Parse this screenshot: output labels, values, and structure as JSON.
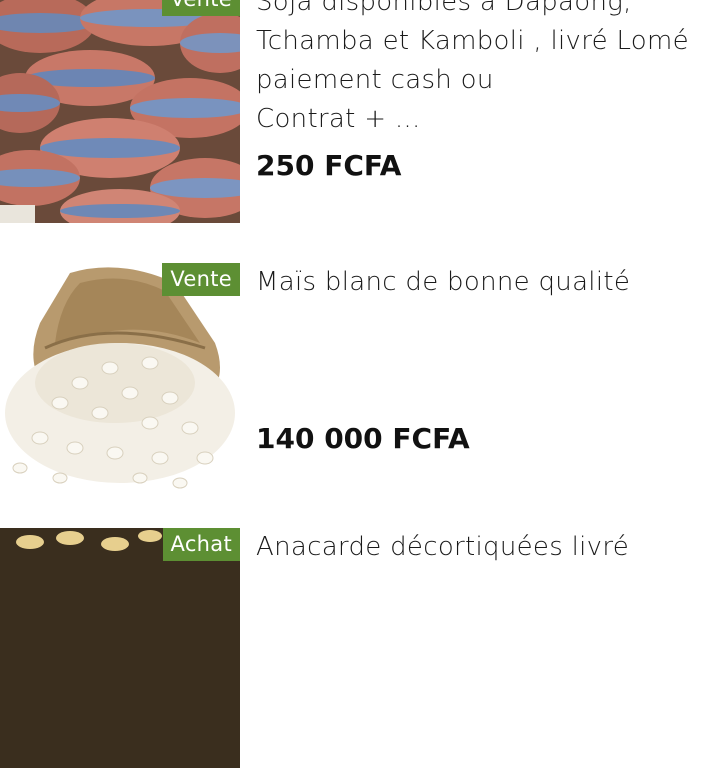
{
  "listings": [
    {
      "badge": "Vente",
      "title_lines": [
        "Soja disponibles à Dapaong,",
        "Tchamba et Kamboli , livré Lomé",
        "paiement cash ou",
        "Contrat + ..."
      ],
      "price": "250 FCFA",
      "image": "sacks-of-soybeans"
    },
    {
      "badge": "Vente",
      "title_lines": [
        "Maïs blanc de bonne qualité"
      ],
      "price": "140 000 FCFA",
      "image": "burlap-sack-white-maize"
    },
    {
      "badge": "Achat",
      "title_lines": [
        "Anacarde décortiquées livré"
      ],
      "image": "cashew-nuts"
    }
  ],
  "colors": {
    "badge_green": "#5d8f33",
    "text": "#1a1a1a"
  }
}
